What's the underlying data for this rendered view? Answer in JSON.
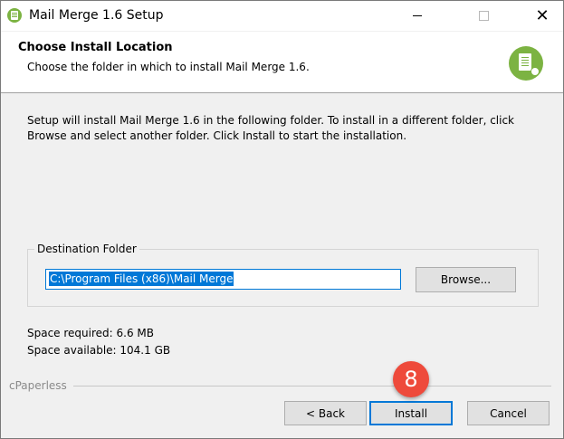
{
  "window": {
    "title": "Mail Merge 1.6 Setup",
    "close_glyph": "✕"
  },
  "header": {
    "title": "Choose Install Location",
    "subtitle": "Choose the folder in which to install Mail Merge 1.6."
  },
  "body": {
    "intro": "Setup will install Mail Merge 1.6 in the following folder. To install in a different folder, click Browse and select another folder. Click Install to start the installation.",
    "destination": {
      "label": "Destination Folder",
      "path": "C:\\Program Files (x86)\\Mail Merge",
      "browse_label": "Browse..."
    },
    "space_required": "Space required: 6.6 MB",
    "space_available": "Space available: 104.1 GB"
  },
  "footer": {
    "brand": "cPaperless",
    "back_label": "< Back",
    "install_label": "Install",
    "cancel_label": "Cancel"
  },
  "annotation": {
    "step_number": "8"
  },
  "icons": {
    "app": "mail-merge-app-icon",
    "logo": "mail-merge-logo-icon",
    "minimize": "minimize-icon",
    "maximize": "maximize-icon",
    "close": "close-icon"
  },
  "colors": {
    "accent": "#0078d7",
    "brand_green": "#7cb342",
    "step_badge": "#ee4a3b"
  }
}
